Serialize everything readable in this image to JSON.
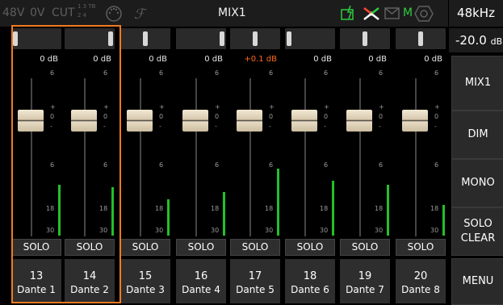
{
  "header": {
    "phantom": "48V",
    "ov": "0V",
    "cut": "CUT",
    "cut_sub_top": "1 3 TB",
    "cut_sub_bot": "2 4",
    "title": "MIX1",
    "m_indicator": "M",
    "sample_rate": "48kHz"
  },
  "level": {
    "value": "-20.0",
    "unit": "dB"
  },
  "side_buttons": [
    {
      "label": "MIX1"
    },
    {
      "label": "DIM"
    },
    {
      "label": "MONO"
    },
    {
      "label": "SOLO\nCLEAR"
    },
    {
      "label": "MENU"
    }
  ],
  "channels": [
    {
      "number": "13",
      "name": "Dante 1",
      "gain": "0 dB",
      "solo": "SOLO",
      "pan_knob": "left",
      "meter": 0.42
    },
    {
      "number": "14",
      "name": "Dante 2",
      "gain": "0 dB",
      "solo": "SOLO",
      "pan_knob": "right",
      "meter": 0.4
    },
    {
      "number": "15",
      "name": "Dante 3",
      "gain": "0 dB",
      "solo": "SOLO",
      "pan_knob": "center",
      "meter": 0.3
    },
    {
      "number": "16",
      "name": "Dante 4",
      "gain": "0 dB",
      "solo": "SOLO",
      "pan_knob": "right",
      "meter": 0.36
    },
    {
      "number": "17",
      "name": "Dante 5",
      "gain": "+0.1 dB",
      "solo": "SOLO",
      "pan_knob": "center",
      "meter": 0.55
    },
    {
      "number": "18",
      "name": "Dante 6",
      "gain": "0 dB",
      "solo": "SOLO",
      "pan_knob": "left",
      "meter": 0.45
    },
    {
      "number": "19",
      "name": "Dante 7",
      "gain": "0 dB",
      "solo": "SOLO",
      "pan_knob": "center",
      "meter": 0.42
    },
    {
      "number": "20",
      "name": "Dante 8",
      "gain": "0 dB",
      "solo": "SOLO",
      "pan_knob": "center",
      "meter": 0.25
    }
  ],
  "scale_labels": {
    "top": "6",
    "plus": "+",
    "zero": "0",
    "minus": "-",
    "mid": "6",
    "low": "18",
    "bottom": "30"
  },
  "colors": {
    "accent_orange": "#f07a22",
    "meter_green": "#23c02b",
    "positive_gain": "#ff6a1a",
    "icon_green": "#2ecc40"
  }
}
